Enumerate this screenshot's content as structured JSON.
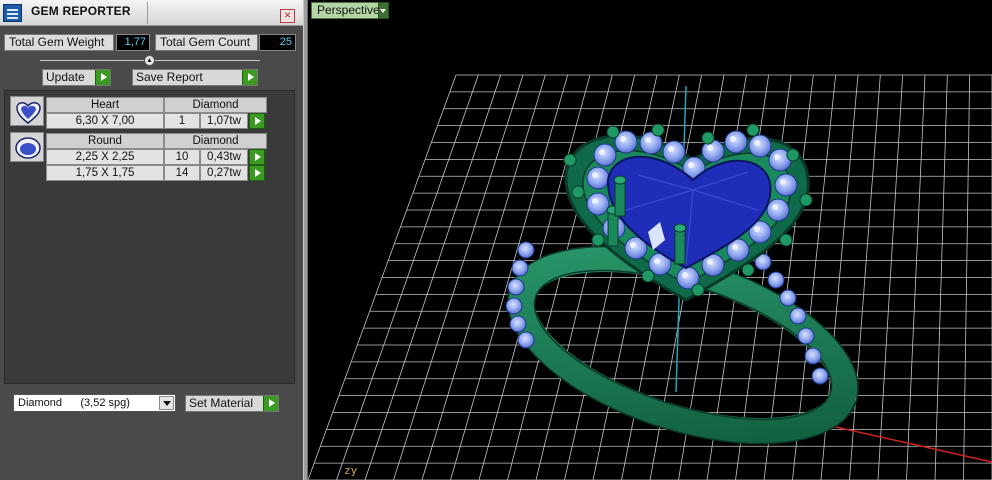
{
  "panel": {
    "title": "GEM REPORTER",
    "close_label": "×",
    "stats": {
      "weight_label": "Total Gem Weight",
      "weight_value": "1,77",
      "count_label": "Total Gem Count",
      "count_value": "25"
    },
    "buttons": {
      "update": "Update",
      "save_report": "Save Report"
    },
    "gem_groups": [
      {
        "icon": "heart-gem-icon",
        "shape": "Heart",
        "material": "Diamond",
        "rows": [
          {
            "size": "6,30 X 7,00",
            "count": "1",
            "weight": "1,07tw"
          }
        ]
      },
      {
        "icon": "round-gem-icon",
        "shape": "Round",
        "material": "Diamond",
        "rows": [
          {
            "size": "2,25 X 2,25",
            "count": "10",
            "weight": "0,43tw"
          },
          {
            "size": "1,75 X 1,75",
            "count": "14",
            "weight": "0,27tw"
          }
        ]
      }
    ],
    "material_select": {
      "value": "Diamond      (3,52 spg)"
    },
    "set_material": "Set Material"
  },
  "viewport": {
    "view_name": "Perspective",
    "axis_label": "zy"
  },
  "colors": {
    "metal": "#1a7a55",
    "gem_main": "#2030c0",
    "accent_green": "#3c9a22",
    "value_text": "#5ad0f0"
  }
}
